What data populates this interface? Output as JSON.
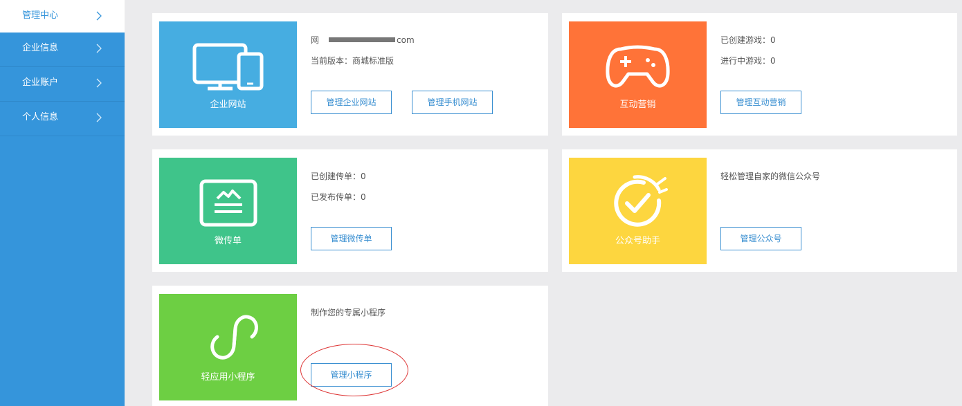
{
  "sidebar": {
    "items": [
      {
        "label": "管理中心",
        "active": true
      },
      {
        "label": "企业信息"
      },
      {
        "label": "企业账户"
      },
      {
        "label": "个人信息"
      }
    ]
  },
  "cards": {
    "website": {
      "tile_label": "企业网站",
      "tile_color": "#46ade1",
      "icon": "computer-and-phone-icon",
      "url_prefix": "网",
      "url_suffix": "com",
      "version": "当前版本：商城标准版",
      "btn1": "管理企业网站",
      "btn2": "管理手机网站"
    },
    "interactive": {
      "tile_label": "互动营销",
      "tile_color": "#ff7338",
      "icon": "gamepad-icon",
      "created": "已创建游戏：0",
      "running": "进行中游戏：0",
      "btn": "管理互动营销"
    },
    "flyer": {
      "tile_label": "微传单",
      "tile_color": "#3fc48a",
      "icon": "flyer-icon",
      "created": "已创建传单：0",
      "published": "已发布传单：0",
      "btn": "管理微传单"
    },
    "official": {
      "tile_label": "公众号助手",
      "tile_color": "#fdd63f",
      "icon": "check-circle-icon",
      "desc": "轻松管理自家的微信公众号",
      "btn": "管理公众号"
    },
    "miniapp": {
      "tile_label": "轻应用小程序",
      "tile_color": "#6dcf43",
      "icon": "miniprogram-icon",
      "desc": "制作您的专属小程序",
      "btn": "管理小程序"
    }
  }
}
